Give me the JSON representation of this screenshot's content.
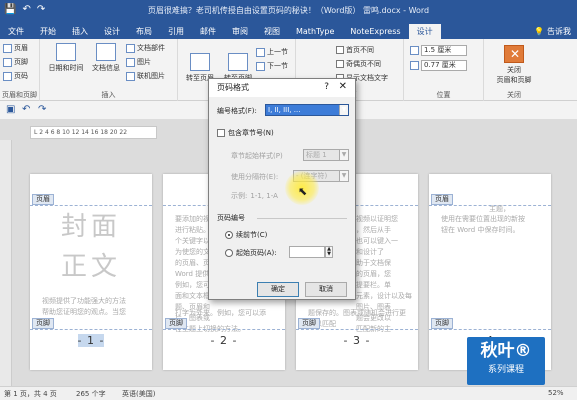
{
  "titlebar": {
    "title": "页眉很难搞？老司机传授自由设置页码的秘诀！（Word版） 雷鸣.docx - Word",
    "qa_save": "💾",
    "qa_undo": "↶",
    "qa_redo": "↷"
  },
  "tabs": [
    "文件",
    "开始",
    "插入",
    "设计",
    "布局",
    "引用",
    "邮件",
    "审阅",
    "视图",
    "MathType",
    "NoteExpress",
    "设计"
  ],
  "tell_me": "告诉我",
  "ribbon": {
    "hf_items": [
      "页眉",
      "页脚",
      "页码"
    ],
    "hf_group": "页眉和页脚",
    "datetime": "日期和时间",
    "docinfo": "文档信息",
    "docparts": "文档部件",
    "picture": "图片",
    "online_picture": "联机图片",
    "insert_group": "插入",
    "goto_header": "转至页眉",
    "goto_footer": "转至页脚",
    "prev_section": "上一节",
    "next_section": "下一节",
    "nav_group": "导航",
    "diff_first": "首页不同",
    "diff_odd_even": "奇偶页不同",
    "show_doc_text": "显示文档文字",
    "options_group": "选项",
    "header_top": "1.5 厘米",
    "footer_bottom": "0.77 厘米",
    "position_group": "位置",
    "close_line1": "关闭",
    "close_line2": "页眉和页脚",
    "close_group": "关闭"
  },
  "ruler_text": "L  2  4  6  8  10  12  14  16  18  20 22",
  "dialog": {
    "title": "页码格式",
    "help": "?",
    "close": "✕",
    "format_label": "编号格式(F):",
    "format_value": "I, II, III, ...",
    "include_chapter": "包含章节号(N)",
    "chapter_style_label": "章节起始样式(P)",
    "chapter_style_value": "标题 1",
    "separator_label": "使用分隔符(E):",
    "separator_value": "-  (连字符)",
    "example_label": "示例:",
    "example_value": "1-1, 1-A",
    "numbering_section": "页码编号",
    "continue_label": "续前节(C)",
    "start_at_label": "起始页码(A):",
    "ok": "确定",
    "cancel": "取消"
  },
  "pages": [
    {
      "header_tag": "页眉",
      "footer_tag": "页脚",
      "big_line1": "封面",
      "big_line2": "正文",
      "body_line1": "视频提供了功能强大的方法",
      "body_line2": "帮助您证明您的观点。当您",
      "page_number": "- 1 -"
    },
    {
      "header_tag": "",
      "footer_tag": "页脚",
      "body_lines": [
        "要添加的视",
        "进行粘贴。",
        "个关键字以",
        "为使您的文",
        "的页眉、页",
        "Word 提供",
        "例如，您可",
        "面和文本框",
        "题、页眉和",
        "片、图表或",
        "在主题上切换的方法。"
      ],
      "body_line_last": "打字为外来。例如，您可以添",
      "page_number": "- 2 -"
    },
    {
      "header_tag": "",
      "footer_tag": "页脚",
      "body_lines": [
        "视频以证明您",
        "，然后从手",
        "也可以键入一",
        "和设计了",
        "助于文档保",
        "的页眉，您",
        "提要栏。单",
        "元素，设计以及每",
        "图片、图表",
        "题会更改以",
        "匹配新的主"
      ],
      "body_line_last": "题保存的。图表或随机会进行更改以匹配",
      "page_number": "- 3 -"
    },
    {
      "header_tag": "页眉",
      "footer_tag": "页脚",
      "body_line1": "主题，",
      "body_line2": "使用在需要位置出现的新按",
      "body_line3": "钮在 Word 中保存时间。",
      "page_number": "- 4 -"
    }
  ],
  "statusbar": {
    "page": "第 1 页，共 4 页",
    "words": "265 个字",
    "lang": "英语(美国)",
    "zoom": "52%"
  },
  "logo": {
    "line1": "秋叶®",
    "line2": "系列课程"
  }
}
